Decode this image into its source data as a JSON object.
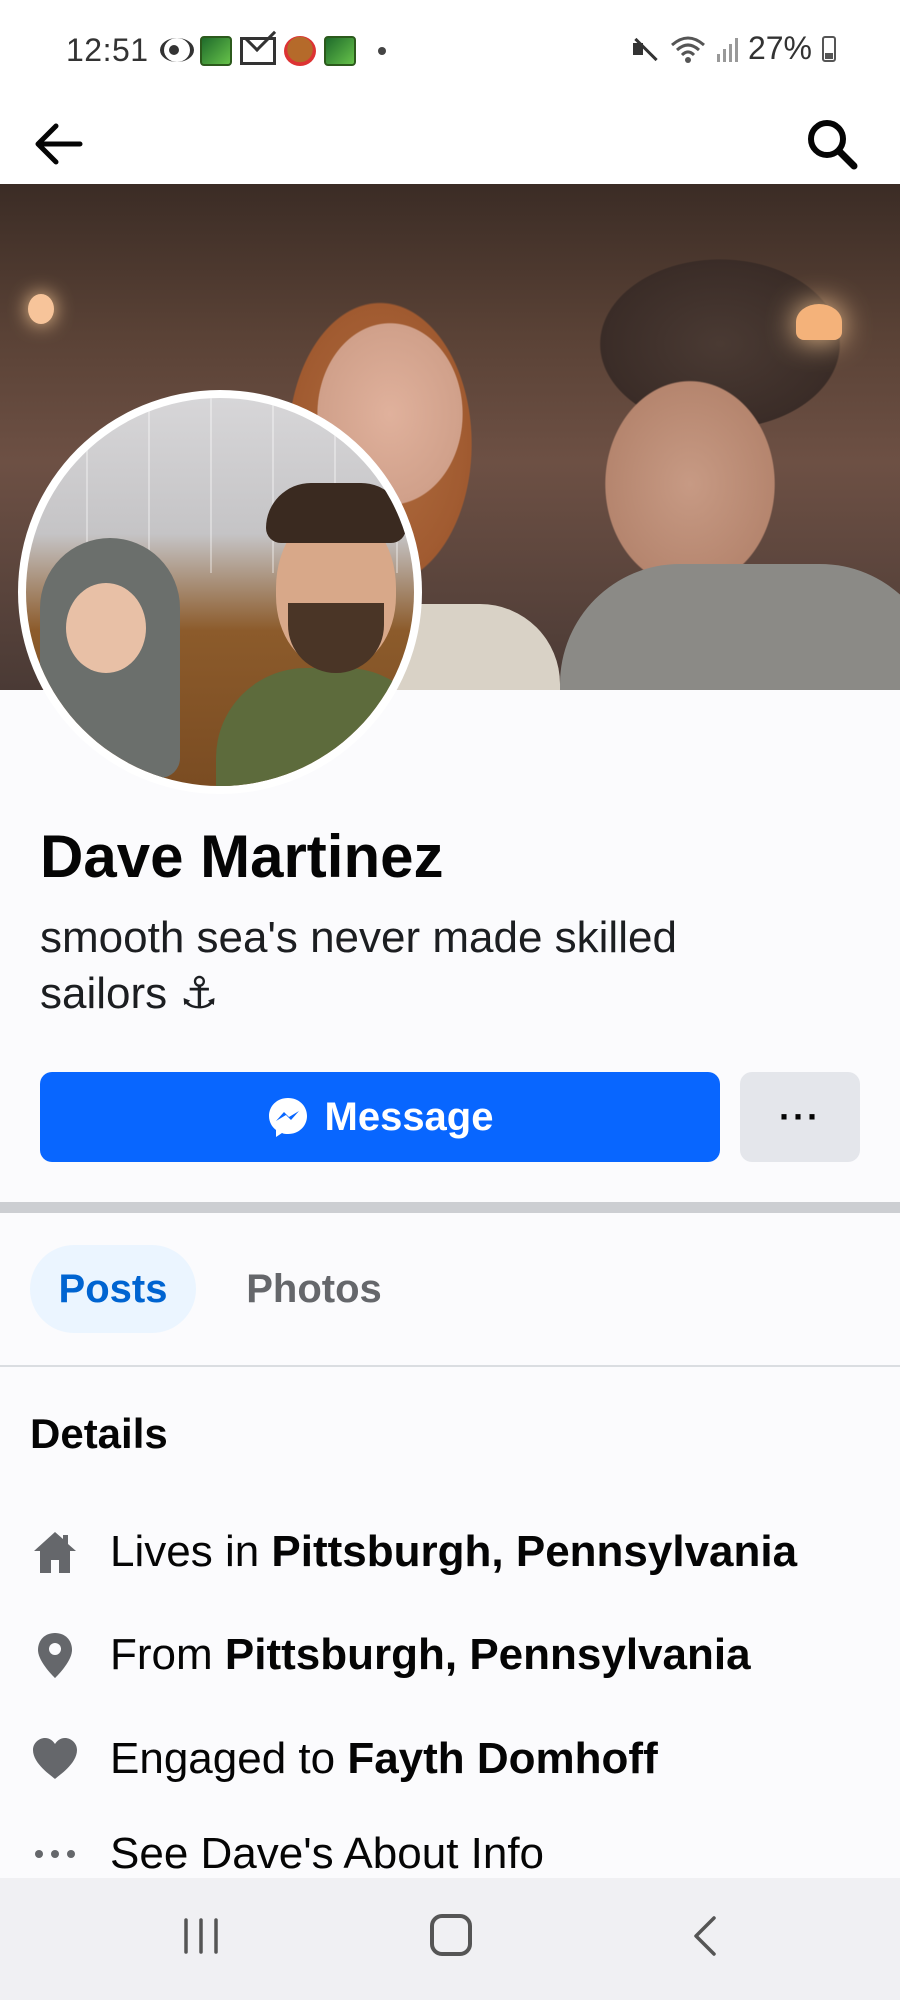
{
  "status_bar": {
    "time": "12:51",
    "battery": "27%",
    "notification_icons": [
      "cast-icon",
      "game-icon",
      "gmail-icon",
      "bear-game-icon",
      "game-icon",
      "dot-icon"
    ],
    "system_icons": [
      "mute-icon",
      "wifi-icon",
      "signal-icon",
      "battery-icon"
    ]
  },
  "app_bar": {
    "back_icon": "arrow-left-icon",
    "search_icon": "search-icon"
  },
  "profile": {
    "name": "Dave Martinez",
    "bio": "smooth sea's never made skilled sailors ⚓"
  },
  "actions": {
    "message_label": "Message",
    "more_label": "···"
  },
  "tabs": [
    {
      "label": "Posts",
      "selected": true
    },
    {
      "label": "Photos",
      "selected": false
    }
  ],
  "details": {
    "title": "Details",
    "items": [
      {
        "icon": "home-icon",
        "prefix": "Lives in ",
        "value": "Pittsburgh, Pennsylvania"
      },
      {
        "icon": "location-pin-icon",
        "prefix": "From ",
        "value": "Pittsburgh, Pennsylvania"
      },
      {
        "icon": "heart-icon",
        "prefix": "Engaged to ",
        "value": "Fayth Domhoff"
      },
      {
        "icon": "more-dots-icon",
        "prefix": "See Dave's About Info",
        "value": ""
      }
    ]
  },
  "colors": {
    "accent_blue": "#0866ff",
    "tab_selected_bg": "#ebf5ff",
    "tab_selected_text": "#0064d1",
    "secondary_button_bg": "#e4e6eb",
    "icon_gray": "#65676b"
  }
}
